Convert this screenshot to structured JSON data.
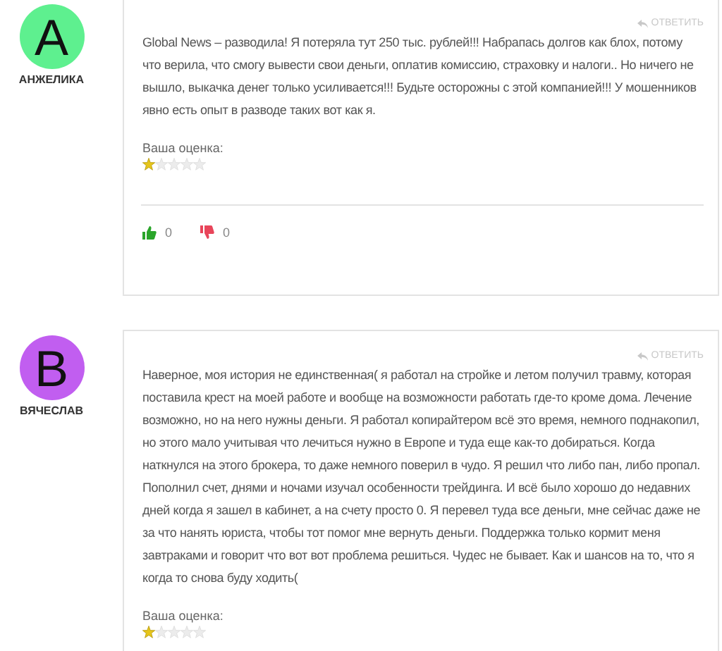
{
  "reviews": [
    {
      "author": "АНЖЕЛИКА",
      "avatar_letter": "A",
      "color": "#5ef08f",
      "reply": "ОТВЕТИТЬ",
      "text": "Global News – разводила! Я потеряла тут 250 тыс. рублей!!! Набрапась долгов как блох, потому что верила, что смогу вывести свои деньги, оплатив комиссию, страховку и налоги.. Но ничего не вышло, выкачка денег только усиливается!!! Будьте осторожны с этой компанией!!! У мошенников явно есть опыт в разводе таких вот как я.",
      "rating_label": "Ваша оценка:",
      "stars": 1,
      "likes": "0",
      "dislikes": "0"
    },
    {
      "author": "ВЯЧЕСЛАВ",
      "avatar_letter": "B",
      "color": "#c15ef0",
      "reply": "ОТВЕТИТЬ",
      "text": "Наверное, моя история не единственная( я работал на стройке и летом получил травму, которая поставила крест на моей работе и вообще на возможности работать где-то кроме дома. Лечение возможно, но на него нужны деньги. Я работал копирайтером всё это время, немного поднакопил, но этого мало учитывая что лечиться нужно в Европе и туда еще как-то добираться. Когда наткнулся на этого брокера, то даже немного поверил в чудо. Я решил что либо пан, либо пропал. Пополнил счет, днями и ночами изучал особенности трейдинга. И всё было хорошо до недавних дней когда я зашел в кабинет, а на счету просто 0. Я перевел туда все деньги, мне сейчас даже не за что нанять юриста, чтобы тот помог мне вернуть деньги. Поддержка только кормит меня завтраками и говорит что вот вот проблема решиться. Чудес не бывает. Как и шансов на то, что я когда то снова буду ходить(",
      "rating_label": "Ваша оценка:",
      "stars": 1
    }
  ]
}
